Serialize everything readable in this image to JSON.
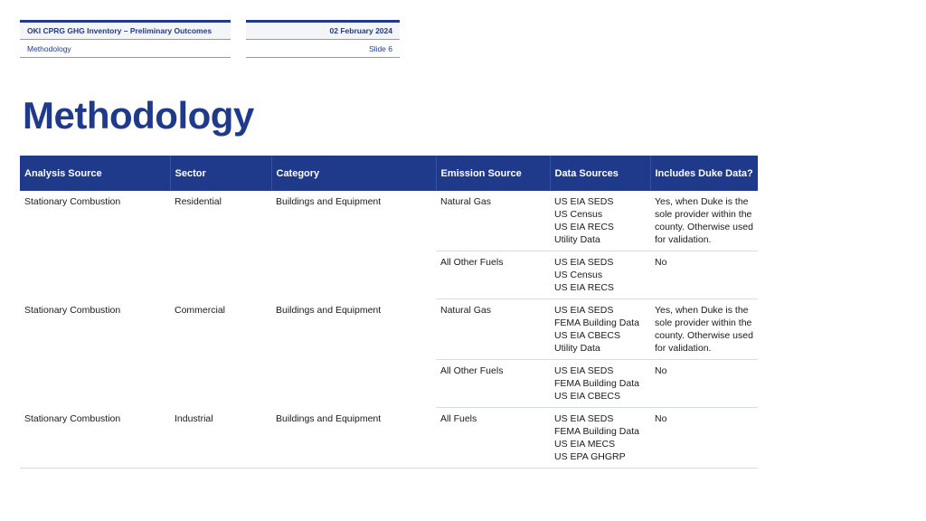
{
  "header": {
    "deck_title": "OKI CPRG GHG Inventory – Preliminary Outcomes",
    "date": "02 February 2024",
    "section": "Methodology",
    "slide": "Slide 6"
  },
  "page_title": "Methodology",
  "table": {
    "columns": [
      "Analysis Source",
      "Sector",
      "Category",
      "Emission Source",
      "Data Sources",
      "Includes Duke Data?"
    ],
    "groups": [
      {
        "analysis_source": "Stationary Combustion",
        "sector": "Residential",
        "category": "Buildings and Equipment",
        "rows": [
          {
            "emission_source": "Natural Gas",
            "data_sources": [
              "US EIA SEDS",
              "US Census",
              "US EIA RECS",
              "Utility Data"
            ],
            "duke": "Yes, when Duke is the sole provider within the county. Otherwise used for validation."
          },
          {
            "emission_source": "All Other Fuels",
            "data_sources": [
              "US EIA SEDS",
              "US Census",
              "US EIA RECS"
            ],
            "duke": "No"
          }
        ]
      },
      {
        "analysis_source": "Stationary Combustion",
        "sector": "Commercial",
        "category": "Buildings and Equipment",
        "rows": [
          {
            "emission_source": "Natural Gas",
            "data_sources": [
              "US EIA SEDS",
              "FEMA Building Data",
              "US EIA CBECS",
              "Utility Data"
            ],
            "duke": "Yes, when Duke is the sole provider within the county. Otherwise used for validation."
          },
          {
            "emission_source": "All Other Fuels",
            "data_sources": [
              "US EIA SEDS",
              "FEMA Building Data",
              "US EIA CBECS"
            ],
            "duke": "No"
          }
        ]
      },
      {
        "analysis_source": "Stationary Combustion",
        "sector": "Industrial",
        "category": "Buildings and Equipment",
        "rows": [
          {
            "emission_source": "All Fuels",
            "data_sources": [
              "US EIA SEDS",
              "FEMA Building Data",
              "US EIA MECS",
              "US EPA GHGRP"
            ],
            "duke": "No"
          }
        ]
      }
    ]
  }
}
